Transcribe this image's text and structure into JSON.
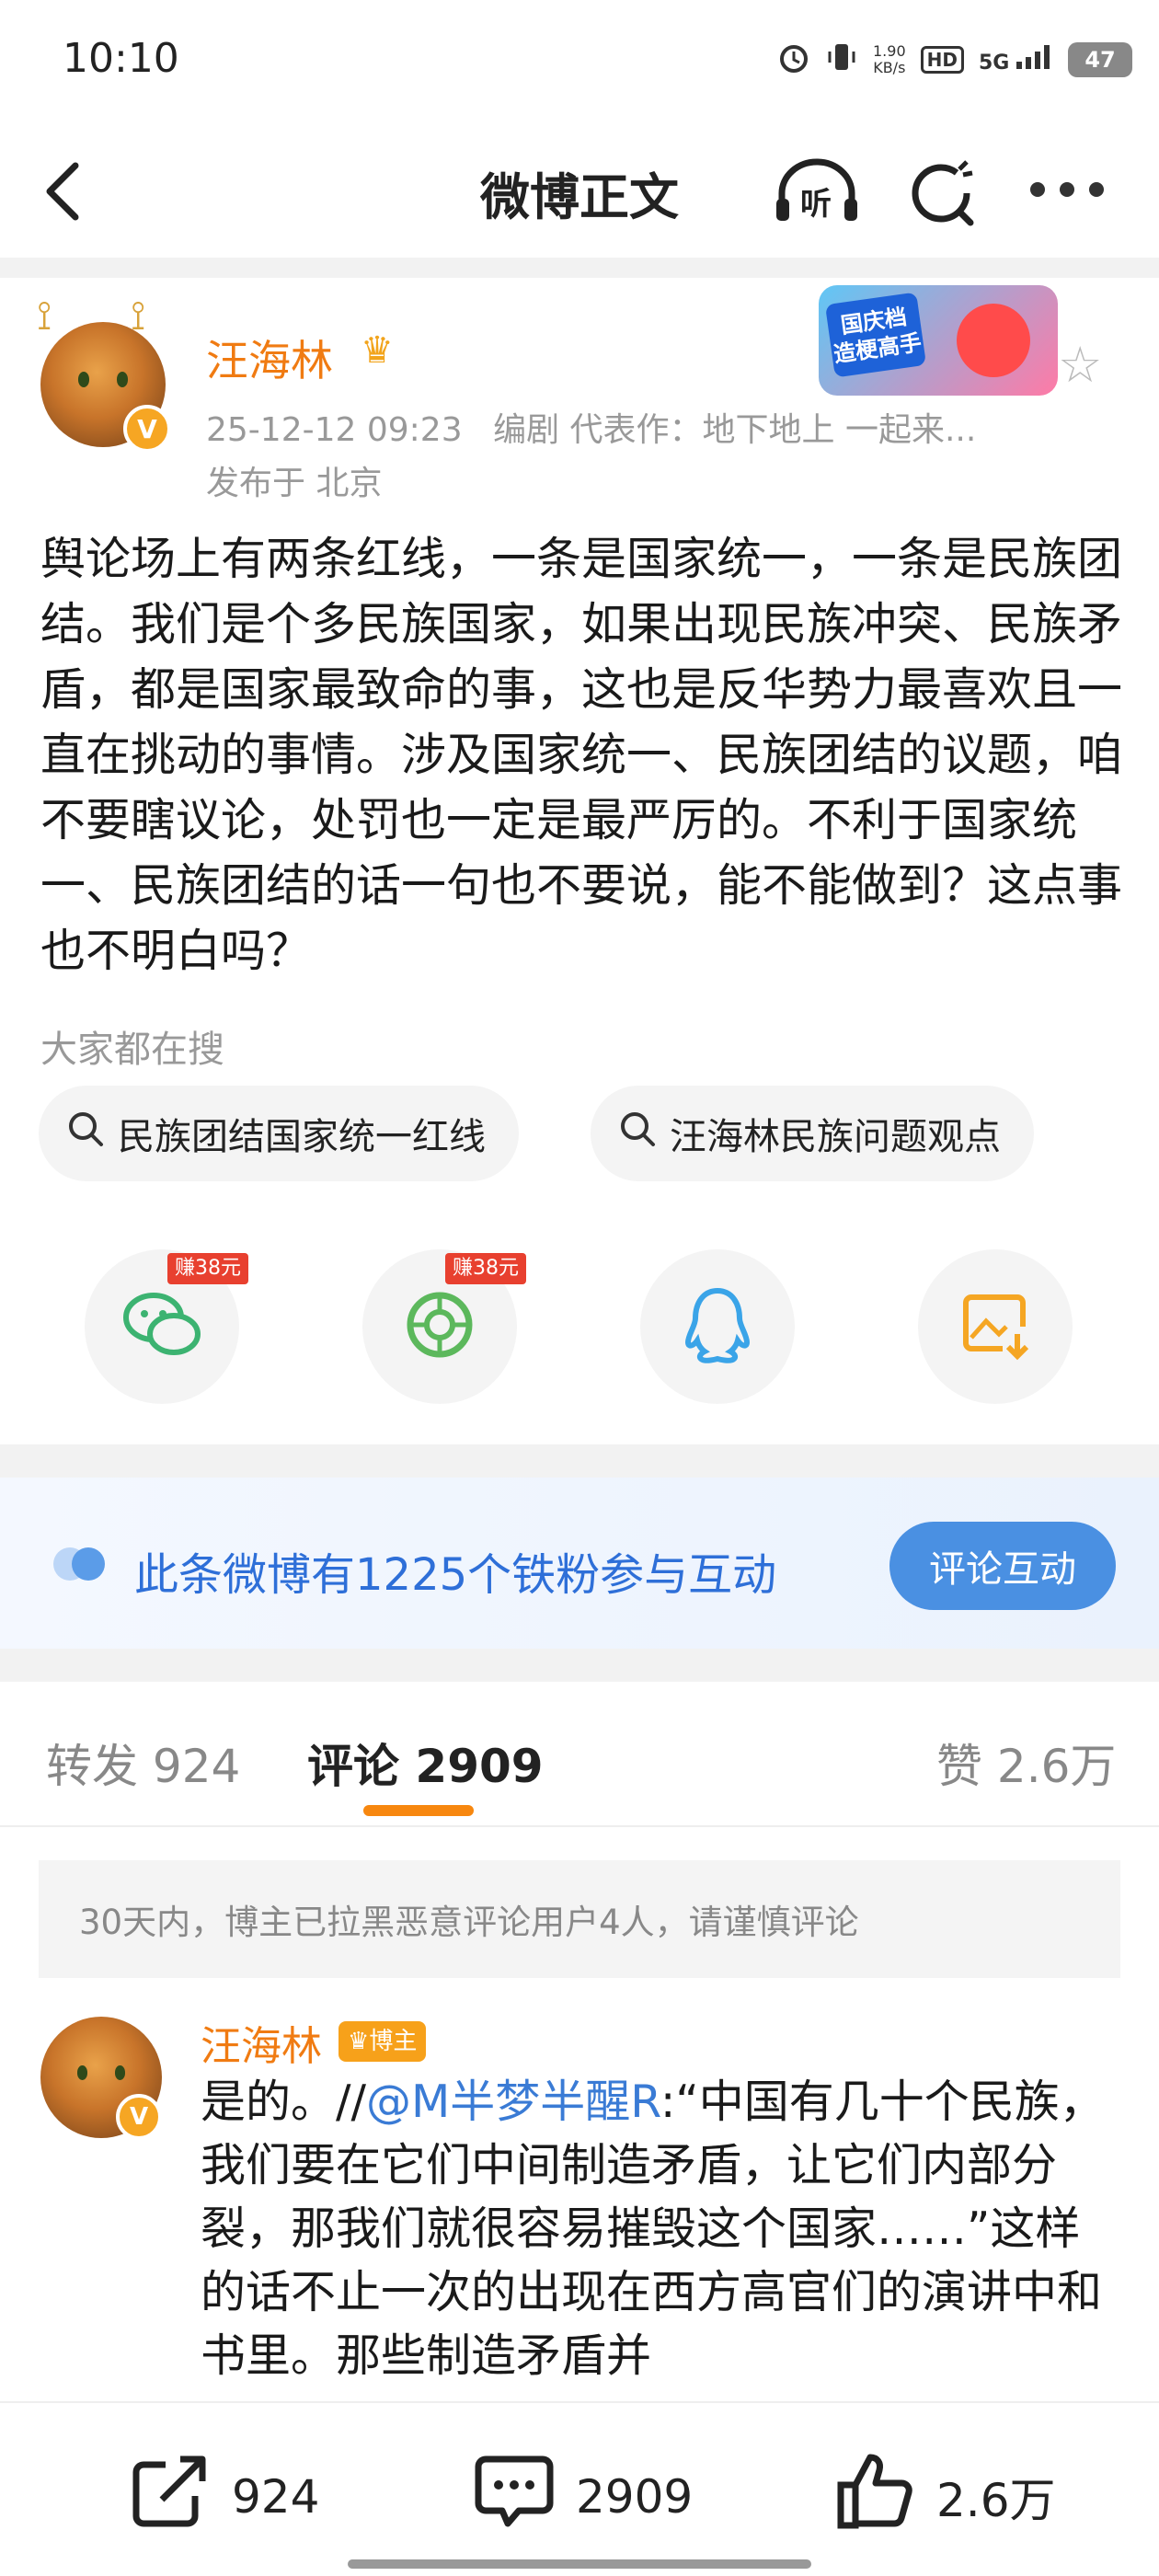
{
  "status_bar": {
    "time": "10:10",
    "net_speed_value": "1.90",
    "net_speed_unit": "KB/s",
    "hd": "HD",
    "signal": "5G",
    "battery": "47"
  },
  "header": {
    "title": "微博正文",
    "listen_label": "听"
  },
  "post": {
    "author": "汪海林",
    "datetime": "25-12-12 09:23",
    "role": "编剧 代表作：地下地上 一起来...",
    "location": "发布于 北京",
    "promo_line1": "国庆档",
    "promo_line2": "造梗高手",
    "text": "舆论场上有两条红线，一条是国家统一，一条是民族团结。我们是个多民族国家，如果出现民族冲突、民族矛盾，都是国家最致命的事，这也是反华势力最喜欢且一直在挑动的事情。涉及国家统一、民族团结的议题，咱不要瞎议论，处罚也一定是最严厉的。不利于国家统一、民族团结的话一句也不要说，能不能做到？这点事也不明白吗？",
    "search_label": "大家都在搜",
    "search_chips": [
      "民族团结国家统一红线",
      "汪海林民族问题观点"
    ]
  },
  "share": {
    "reward_1": "赚38元",
    "reward_2": "赚38元",
    "icons": [
      "wechat-icon",
      "moments-icon",
      "qq-icon",
      "save-image-icon"
    ]
  },
  "fan_banner": {
    "text": "此条微博有1225个铁粉参与互动",
    "button": "评论互动"
  },
  "tabs": {
    "repost": "转发 924",
    "comment": "评论 2909",
    "like": "赞 2.6万"
  },
  "notice": "30天内，博主已拉黑恶意评论用户4人，请谨慎评论",
  "comment": {
    "author": "汪海林",
    "badge": "博主",
    "prefix": "是的。//",
    "mention": "@M半梦半醒R",
    "text": ":“中国有几十个民族，我们要在它们中间制造矛盾，让它们内部分裂，那我们就很容易摧毁这个国家……”这样的话不止一次的出现在西方高官们的演讲中和书里。那些制造矛盾并"
  },
  "bottom_bar": {
    "repost": "924",
    "comment": "2909",
    "like": "2.6万"
  },
  "colors": {
    "accent_orange": "#f07b12",
    "link_blue": "#3a7bd5",
    "button_blue": "#4a90e2",
    "tab_underline": "#f7870f"
  }
}
